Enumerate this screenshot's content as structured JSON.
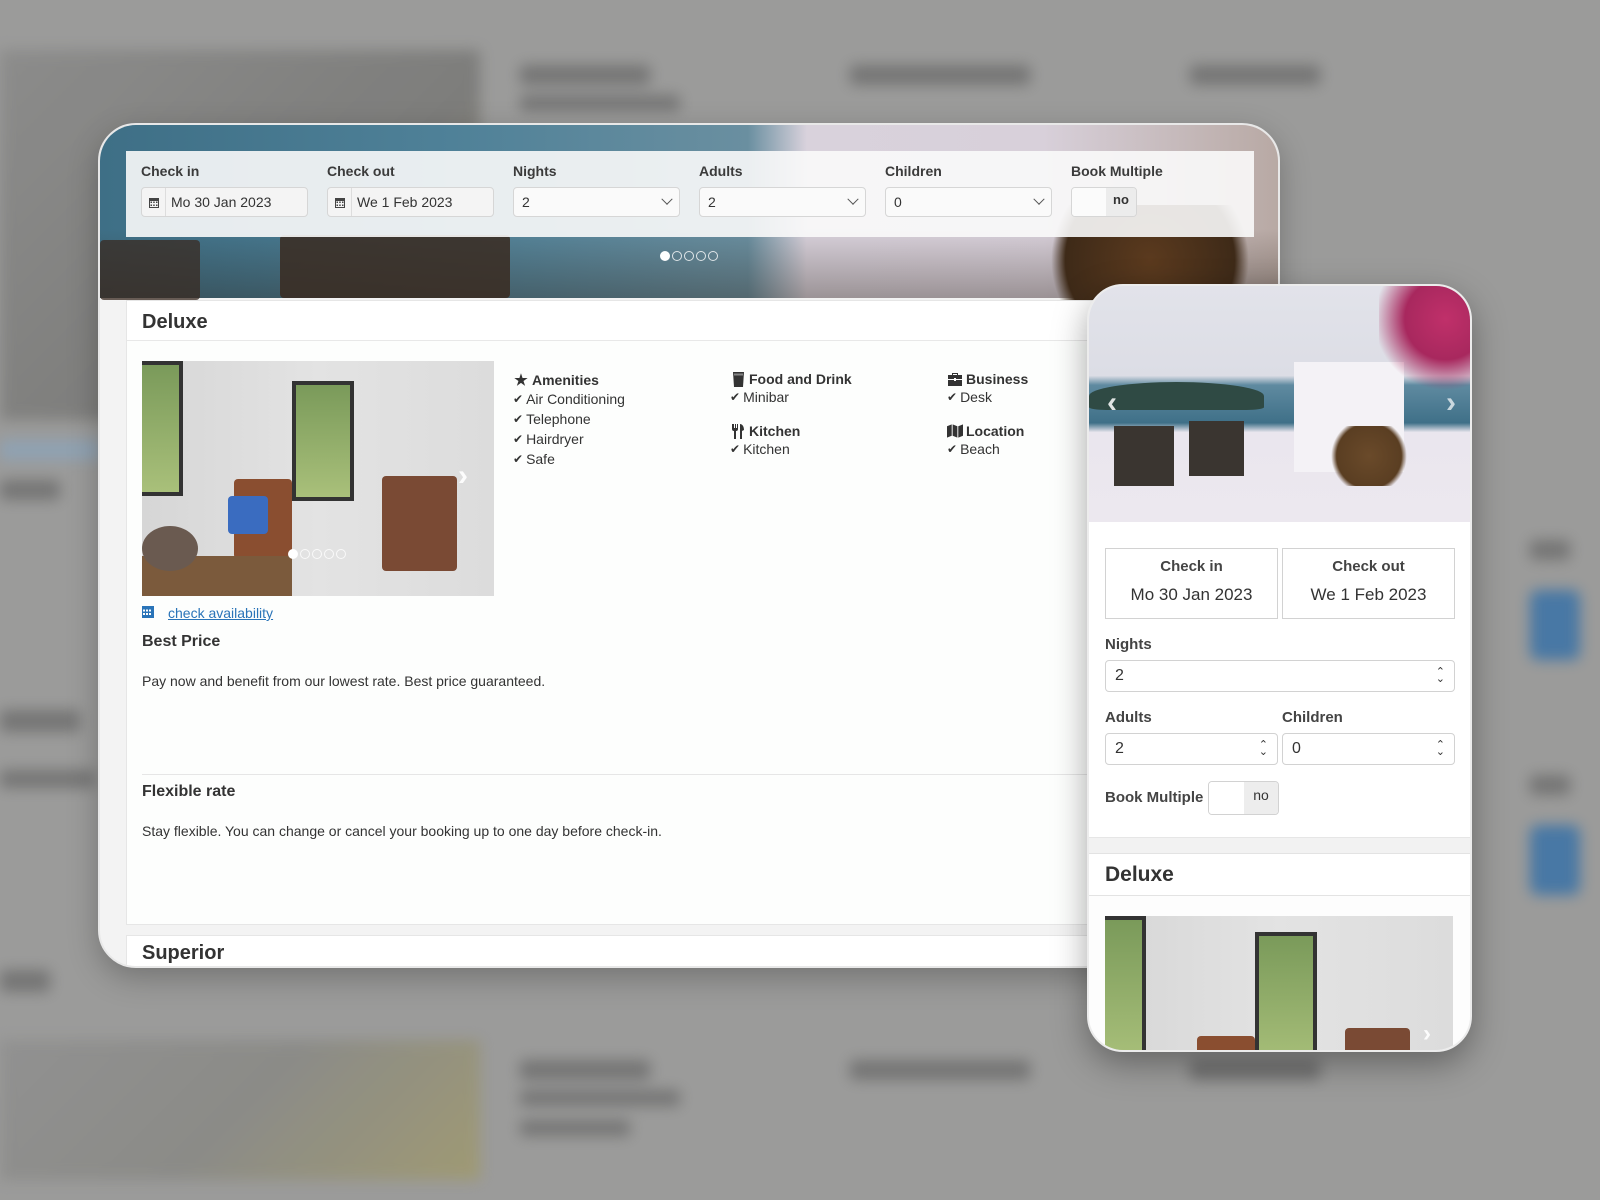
{
  "colors": {
    "link": "#2a74b8",
    "text": "#333333",
    "background_blur": "#9b9b9a"
  },
  "desktop": {
    "search": {
      "check_in": {
        "label": "Check in",
        "value": "Mo 30 Jan 2023",
        "icon": "calendar-icon"
      },
      "check_out": {
        "label": "Check out",
        "value": "We 1 Feb 2023",
        "icon": "calendar-icon"
      },
      "nights": {
        "label": "Nights",
        "value": "2"
      },
      "adults": {
        "label": "Adults",
        "value": "2"
      },
      "children": {
        "label": "Children",
        "value": "0"
      },
      "book_multiple": {
        "label": "Book Multiple",
        "value": "no"
      }
    },
    "hero_slides": {
      "count": 5,
      "active": 1
    },
    "room": {
      "title": "Deluxe",
      "photo_slides": {
        "count": 5,
        "active": 1
      },
      "amenity_groups": [
        {
          "icon": "star-icon",
          "glyph": "★",
          "title": "Amenities",
          "items": [
            "Air Conditioning",
            "Telephone",
            "Hairdryer",
            "Safe"
          ]
        },
        {
          "icon": "glass-icon",
          "glyph": "▮",
          "title": "Food and Drink",
          "items": [
            "Minibar"
          ]
        },
        {
          "icon": "cutlery-icon",
          "glyph": "🍴",
          "title": "Kitchen",
          "items": [
            "Kitchen"
          ]
        },
        {
          "icon": "briefcase-icon",
          "glyph": "💼",
          "title": "Business",
          "items": [
            "Desk"
          ]
        },
        {
          "icon": "map-icon",
          "glyph": "▥",
          "title": "Location",
          "items": [
            "Beach"
          ]
        }
      ],
      "check_availability": "check availability",
      "rates": [
        {
          "title": "Best Price",
          "description": "Pay now and benefit from our lowest rate. Best price guaranteed."
        },
        {
          "title": "Flexible rate",
          "description": "Stay flexible. You can change or cancel your booking up to one day before check-in."
        }
      ]
    },
    "next_room_title": "Superior"
  },
  "mobile": {
    "check_in": {
      "label": "Check in",
      "value": "Mo 30 Jan 2023"
    },
    "check_out": {
      "label": "Check out",
      "value": "We 1 Feb 2023"
    },
    "nights": {
      "label": "Nights",
      "value": "2"
    },
    "adults": {
      "label": "Adults",
      "value": "2"
    },
    "children": {
      "label": "Children",
      "value": "0"
    },
    "book_multiple": {
      "label": "Book Multiple",
      "value": "no"
    },
    "room_title": "Deluxe"
  }
}
